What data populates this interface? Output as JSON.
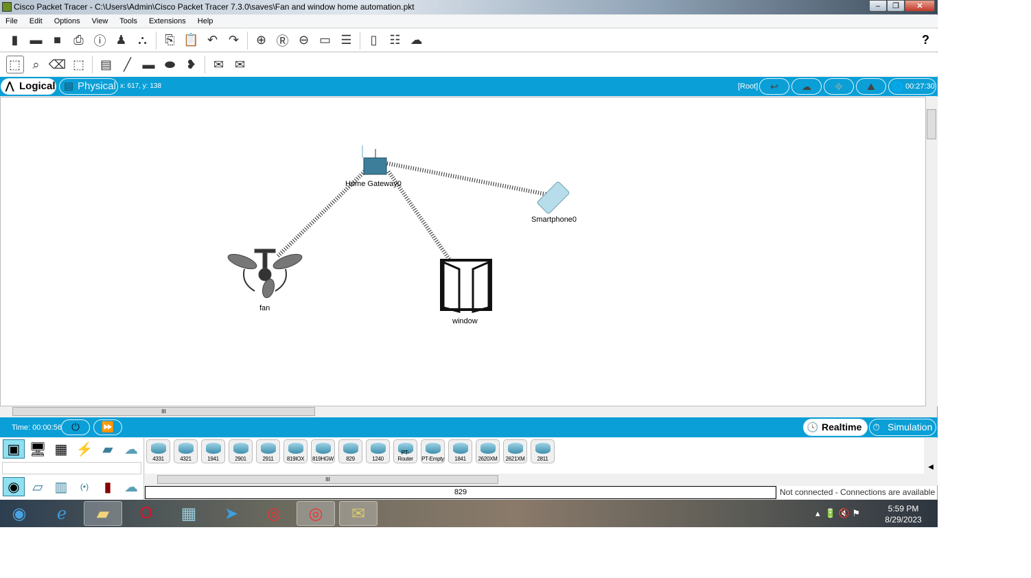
{
  "window": {
    "title": "Cisco Packet Tracer - C:\\Users\\Admin\\Cisco Packet Tracer 7.3.0\\saves\\Fan and window home automation.pkt"
  },
  "menu": [
    "File",
    "Edit",
    "Options",
    "View",
    "Tools",
    "Extensions",
    "Help"
  ],
  "toolbar": {
    "help": "?"
  },
  "viewbar": {
    "logical": "Logical",
    "physical": "Physical",
    "coords": "x: 617, y: 138",
    "root": "[Root]",
    "clock": "00:27:30"
  },
  "nodes": {
    "gateway": "Home Gateway0",
    "smartphone": "Smartphone0",
    "fan": "fan",
    "window": "window"
  },
  "timebar": {
    "time": "Time: 00:00:56",
    "realtime": "Realtime",
    "simulation": "Simulation"
  },
  "models": [
    "4331",
    "4321",
    "1941",
    "2901",
    "2911",
    "819IOX",
    "819HGW",
    "829",
    "1240",
    "PT-Router",
    "PT-Empty",
    "1841",
    "2620XM",
    "2621XM",
    "2811"
  ],
  "selected_model": "829",
  "status": "Not connected - Connections are available",
  "taskbar": {
    "time": "5:59 PM",
    "date": "8/29/2023"
  },
  "colors": {
    "accent": "#0a9fd6"
  }
}
